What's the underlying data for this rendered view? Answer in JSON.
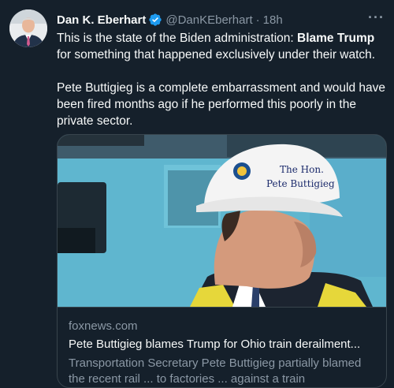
{
  "tweet": {
    "author_name": "Dan K. Eberhart",
    "handle": "@DanKEberhart",
    "separator": "·",
    "time": "18h",
    "more_label": "···",
    "text": {
      "line1_prefix": "This is the state of the Biden administration: ",
      "line1_bold": "Blame Trump",
      "line1_suffix": " for something that happened exclusively under their watch.",
      "paragraph2": "Pete Buttigieg is a complete embarrassment and would have been fired months ago if he performed this poorly in the private sector."
    }
  },
  "card": {
    "domain": "foxnews.com",
    "title": "Pete Buttigieg blames Trump for Ohio train derailment...",
    "description": "Transportation Secretary Pete Buttigieg partially blamed the recent rail ... to factories ... against a train",
    "hardhat_text_1": "The Hon.",
    "hardhat_text_2": "Pete Buttigieg"
  },
  "colors": {
    "background": "#15202b",
    "verified_badge": "#1d9bf0",
    "secondary_text": "#8b98a5",
    "border": "#38444d"
  },
  "icons": {
    "verified": "verified-badge-icon",
    "more": "more-options-icon"
  }
}
